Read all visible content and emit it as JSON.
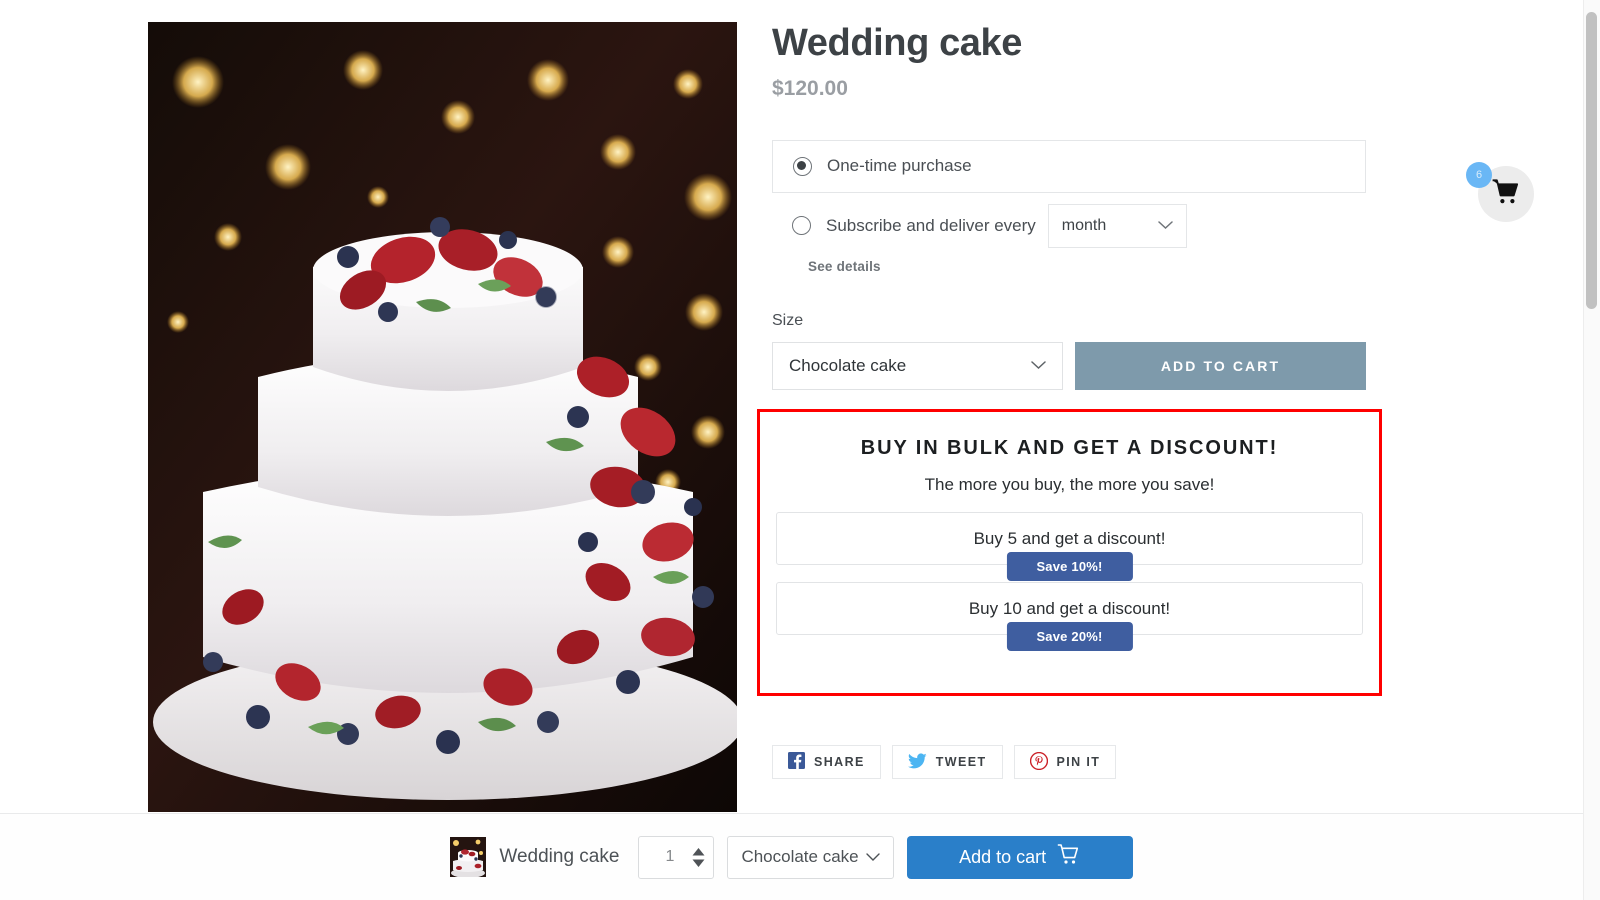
{
  "product": {
    "title": "Wedding cake",
    "price": "$120.00",
    "image_alt": "wedding-cake-photo"
  },
  "purchase_options": {
    "one_time": {
      "label": "One-time purchase",
      "selected": true
    },
    "subscribe": {
      "label": "Subscribe and deliver every",
      "selected": false
    },
    "interval_value": "month",
    "see_details": "See details"
  },
  "size": {
    "label": "Size",
    "selected": "Chocolate cake"
  },
  "add_to_cart_main": "ADD TO CART",
  "bulk": {
    "heading": "BUY IN BULK AND GET A DISCOUNT!",
    "subheading": "The more you buy, the more you save!",
    "offers": [
      {
        "text": "Buy 5 and get a discount!",
        "badge": "Save 10%!"
      },
      {
        "text": "Buy 10 and get a discount!",
        "badge": "Save 20%!"
      }
    ],
    "highlight_color": "#ff0000",
    "badge_color": "#3f5ea0"
  },
  "share": [
    {
      "label": "SHARE",
      "icon": "facebook-icon",
      "color": "#3b5998"
    },
    {
      "label": "TWEET",
      "icon": "twitter-icon",
      "color": "#4cb5f2"
    },
    {
      "label": "PIN IT",
      "icon": "pinterest-icon",
      "color": "#cb2027"
    }
  ],
  "floating_cart": {
    "badge_count": "6",
    "icon": "shopping-cart-icon",
    "badge_color": "#6ab7f5"
  },
  "sticky_bar": {
    "product_title": "Wedding cake",
    "quantity": "1",
    "variant": "Chocolate cake",
    "add_to_cart": "Add to cart",
    "button_color": "#2a7fc9"
  }
}
